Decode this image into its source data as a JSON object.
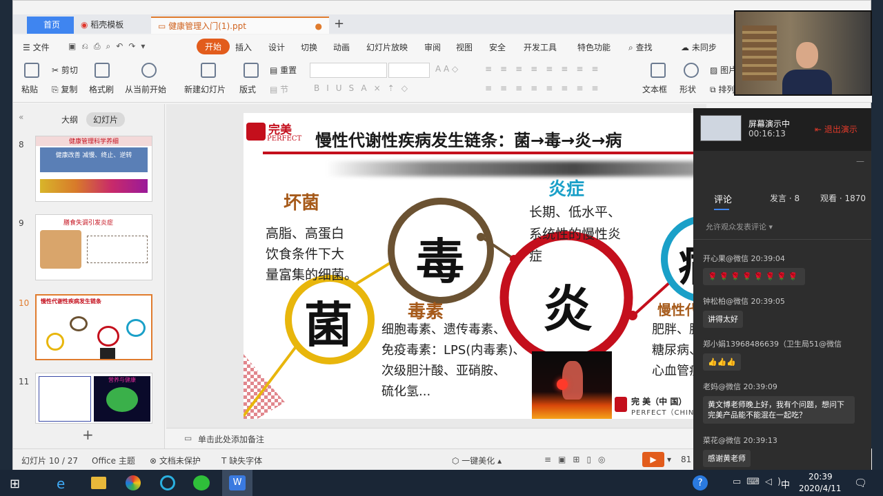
{
  "window": {
    "tabs": [
      {
        "label": "首页"
      },
      {
        "label": "稻壳模板"
      },
      {
        "label": "健康管理入门(1).ppt"
      }
    ],
    "new_tab": "+"
  },
  "menu": {
    "file": "文件",
    "items": [
      "开始",
      "插入",
      "设计",
      "切换",
      "动画",
      "幻灯片放映",
      "审阅",
      "视图",
      "安全",
      "开发工具",
      "特色功能"
    ],
    "search": "查找",
    "sync": "未同步"
  },
  "ribbon": {
    "paste": "粘贴",
    "cut": "剪切",
    "copy": "复制",
    "format_painter": "格式刷",
    "from_current": "从当前开始",
    "new_slide": "新建幻灯片",
    "layout": "版式",
    "reset": "重置",
    "section": "节",
    "textbox": "文本框",
    "shape": "形状",
    "picture": "图片",
    "arrange": "排列"
  },
  "sidebar": {
    "tabs": [
      "大纲",
      "幻灯片"
    ],
    "slides": [
      {
        "num": "8",
        "title": "健康管理科学养细",
        "sub": "健康改善 减慢、终止、逆转"
      },
      {
        "num": "9",
        "title": "膳食失调引发炎症"
      },
      {
        "num": "10",
        "title": "慢性代谢性疾病发生链条"
      },
      {
        "num": "11",
        "title": "营养与健康"
      }
    ],
    "add": "+"
  },
  "slide": {
    "brand_cn": "完美",
    "brand_en": "PERFECT",
    "title": "慢性代谢性疾病发生链条：菌→毒→炎→病",
    "bad_bacteria": {
      "heading": "坏菌",
      "lines": [
        "高脂、高蛋白",
        "饮食条件下大",
        "量富集的细菌。"
      ]
    },
    "circle_bacteria": "菌",
    "circle_toxin": "毒",
    "circle_inflammation": "炎",
    "circle_disease": "病",
    "inflammation": {
      "heading": "炎症",
      "lines": [
        "长期、低水平、",
        "系统性的慢性炎",
        "症"
      ]
    },
    "toxin": {
      "heading": "毒素",
      "lines": [
        "细胞毒素、遗传毒素、",
        "免疫毒素：LPS(内毒素)、",
        "次级胆汁酸、亚硝胺、",
        "硫化氢..."
      ]
    },
    "disease": {
      "heading": "慢性代谢",
      "lines": [
        "肥胖、胰",
        "糖尿病、",
        "心血管疾"
      ]
    },
    "footer_cn": "完 美（中 国）",
    "footer_en": "PERFECT（CHINA"
  },
  "notes_placeholder": "单击此处添加备注",
  "status": {
    "slide_counter": "幻灯片 10 / 27",
    "theme": "Office 主题",
    "protect": "文档未保护",
    "font_missing": "缺失字体",
    "beautify": "一键美化",
    "zoom": "81"
  },
  "live": {
    "state": "屏幕演示中",
    "elapsed": "00:16:13",
    "exit": "退出演示",
    "tabs": {
      "comments": "评论",
      "speak": "发言 · 8",
      "watch": "观看 · 1870"
    },
    "allow_comment": "允许观众发表评论",
    "comments": [
      {
        "name": "开心果@微信",
        "time": "20:39:04",
        "kind": "hearts",
        "text": "🌹🌹🌹🌹🌹🌹🌹🌹"
      },
      {
        "name": "钟松柏@微信",
        "time": "20:39:05",
        "kind": "text",
        "text": "讲得太好"
      },
      {
        "name": "郑小娟13968486639（卫生局51@微信",
        "time": "",
        "kind": "text",
        "text": "👍👍👍"
      },
      {
        "name": "老妈@微信",
        "time": "20:39:09",
        "kind": "text",
        "text": "黄文博老师晚上好，我有个问题，想问下完美产品能不能混在一起吃？"
      },
      {
        "name": "菜花@微信",
        "time": "20:39:13",
        "kind": "text",
        "text": "感谢黄老师"
      }
    ]
  },
  "taskbar": {
    "time": "20:39",
    "date": "2020/4/11",
    "ime": "中"
  }
}
